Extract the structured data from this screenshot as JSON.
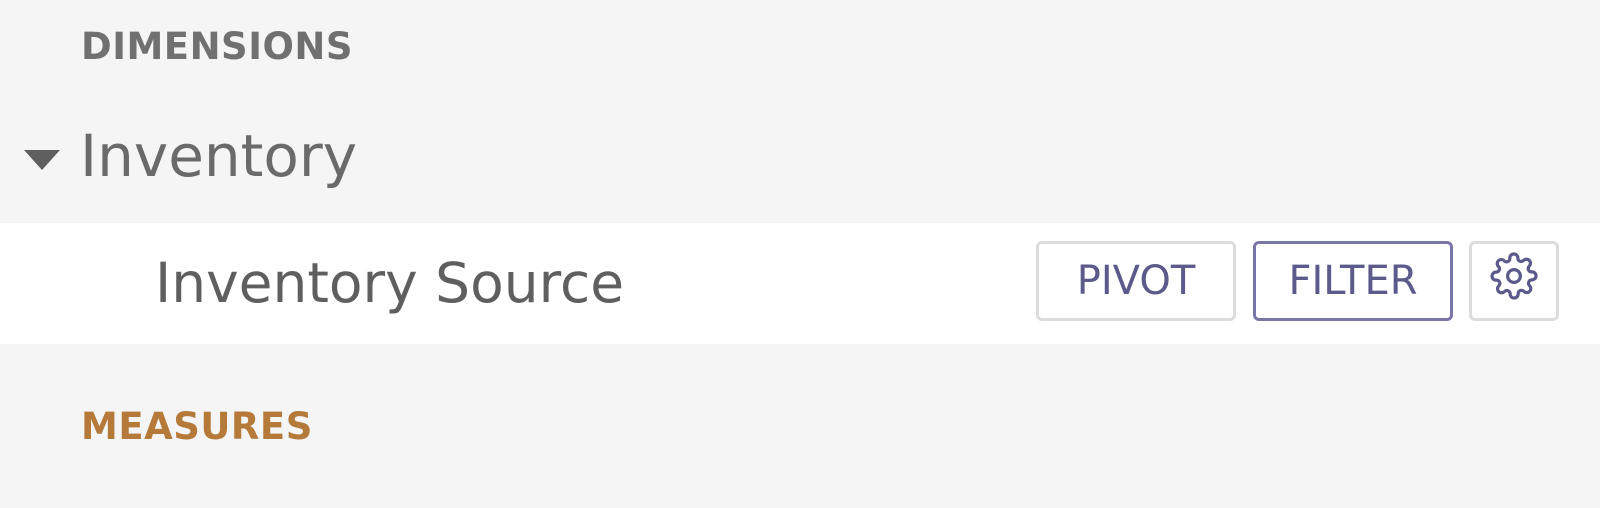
{
  "sections": {
    "dimensions_label": "DIMENSIONS",
    "measures_label": "MEASURES"
  },
  "group": {
    "label": "Inventory",
    "expanded": true,
    "caret_icon": "caret-down-icon"
  },
  "field": {
    "label": "Inventory Source",
    "pivot_label": "PIVOT",
    "filter_label": "FILTER",
    "settings_icon": "gear-icon"
  },
  "colors": {
    "dimensions_text": "#707070",
    "measures_text": "#b57a3a",
    "button_text": "#5c5a8a",
    "filter_border": "#7b76a8"
  }
}
